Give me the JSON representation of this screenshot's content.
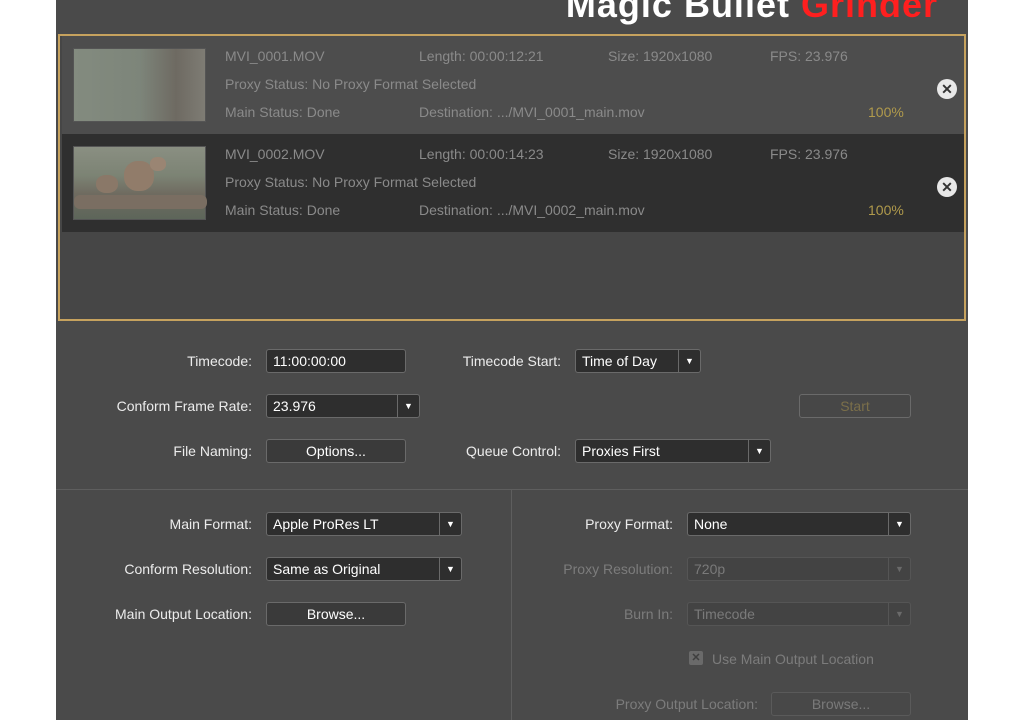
{
  "app": {
    "title_part1": "Magic Bullet",
    "title_part2": "Grinder"
  },
  "queue": {
    "items": [
      {
        "filename": "MVI_0001.MOV",
        "length": "Length: 00:00:12:21",
        "size": "Size: 1920x1080",
        "fps": "FPS: 23.976",
        "proxy_status": "Proxy Status: No Proxy Format Selected",
        "main_status": "Main Status: Done",
        "destination": "Destination: .../MVI_0001_main.mov",
        "progress": "100%",
        "remove_icon": "close-circle-icon"
      },
      {
        "filename": "MVI_0002.MOV",
        "length": "Length: 00:00:14:23",
        "size": "Size: 1920x1080",
        "fps": "FPS: 23.976",
        "proxy_status": "Proxy Status: No Proxy Format Selected",
        "main_status": "Main Status: Done",
        "destination": "Destination: .../MVI_0002_main.mov",
        "progress": "100%",
        "remove_icon": "close-circle-icon"
      }
    ]
  },
  "settings": {
    "timecode_label": "Timecode:",
    "timecode_value": "11:00:00:00",
    "timecode_start_label": "Timecode Start:",
    "timecode_start_value": "Time of Day",
    "conform_frame_rate_label": "Conform Frame Rate:",
    "conform_frame_rate_value": "23.976",
    "start_button": "Start",
    "file_naming_label": "File Naming:",
    "options_button": "Options...",
    "queue_control_label": "Queue Control:",
    "queue_control_value": "Proxies First"
  },
  "main_output": {
    "main_format_label": "Main Format:",
    "main_format_value": "Apple ProRes LT",
    "conform_resolution_label": "Conform Resolution:",
    "conform_resolution_value": "Same as Original",
    "main_output_location_label": "Main Output Location:",
    "browse_button": "Browse..."
  },
  "proxy_output": {
    "proxy_format_label": "Proxy Format:",
    "proxy_format_value": "None",
    "proxy_resolution_label": "Proxy Resolution:",
    "proxy_resolution_value": "720p",
    "burn_in_label": "Burn In:",
    "burn_in_value": "Timecode",
    "use_main_output_label": "Use Main Output Location",
    "use_main_output_checked": true,
    "proxy_output_location_label": "Proxy Output Location:",
    "browse_button": "Browse..."
  },
  "colors": {
    "window_bg": "#4a4a4a",
    "queue_border": "#c6a25e",
    "progress_text": "#b09a4c",
    "brand_red": "#ff1f1f"
  }
}
